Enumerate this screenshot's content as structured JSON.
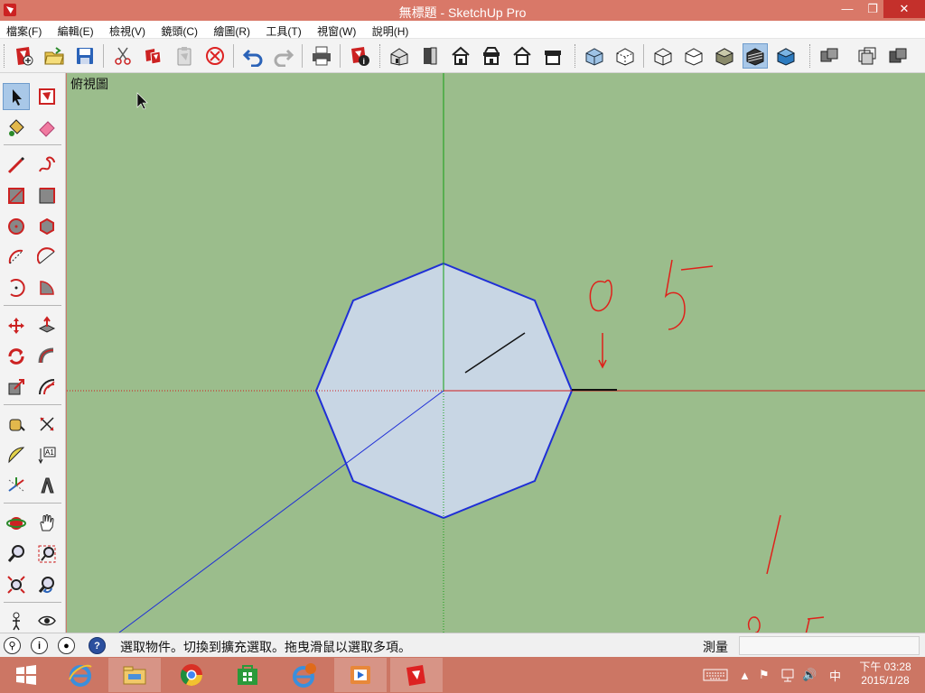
{
  "window": {
    "title": "無標題 - SketchUp Pro",
    "min_label": "—",
    "max_label": "❐",
    "close_label": "✕"
  },
  "menu": [
    {
      "label": "檔案(F)"
    },
    {
      "label": "編輯(E)"
    },
    {
      "label": "檢視(V)"
    },
    {
      "label": "鏡頭(C)"
    },
    {
      "label": "繪圖(R)"
    },
    {
      "label": "工具(T)"
    },
    {
      "label": "視窗(W)"
    },
    {
      "label": "說明(H)"
    }
  ],
  "toolbar_icons": [
    "new-icon",
    "open-icon",
    "save-icon",
    "cut-icon",
    "copy-icon",
    "paste-icon",
    "erase-icon",
    "undo-icon",
    "redo-icon",
    "print-icon",
    "model-info-icon",
    "iso-view-icon",
    "top-view-icon",
    "front-view-icon",
    "right-view-icon",
    "back-view-icon",
    "left-view-icon",
    "xray-icon",
    "back-edges-icon",
    "wireframe-icon",
    "hidden-line-icon",
    "shaded-icon",
    "shaded-textures-icon",
    "monochrome-icon",
    "component-icon",
    "group-icon",
    "outer-shell-icon"
  ],
  "left_tools": [
    "select-icon",
    "make-component-icon",
    "paint-bucket-icon",
    "eraser-icon",
    "line-icon",
    "freehand-icon",
    "rectangle-icon",
    "rotated-rectangle-icon",
    "circle-icon",
    "polygon-icon",
    "arc-icon",
    "two-point-arc-icon",
    "three-point-arc-icon",
    "pie-icon",
    "move-icon",
    "push-pull-icon",
    "rotate-icon",
    "follow-me-icon",
    "scale-icon",
    "offset-icon",
    "tape-measure-icon",
    "dimension-icon",
    "protractor-icon",
    "text-icon",
    "axes-icon",
    "3d-text-icon",
    "orbit-icon",
    "pan-icon",
    "zoom-icon",
    "zoom-window-icon",
    "zoom-extents-icon",
    "previous-view-icon",
    "position-camera-icon",
    "look-around-icon"
  ],
  "viewport": {
    "view_name": "俯視圖",
    "background": "#9bbd8c",
    "polygon_fill": "#c8d6e4",
    "polygon_edge": "#1f2fd6",
    "red_axis": "#d01c1c",
    "green_axis": "#15a015",
    "blue_axis": "#1f2fd6",
    "annotation_color": "#e0201a"
  },
  "status": {
    "message": "選取物件。切換到擴充選取。拖曳滑鼠以選取多項。",
    "measurement_label": "測量",
    "measurement_value": ""
  },
  "taskbar": {
    "apps": [
      "start-icon",
      "internet-explorer-icon",
      "file-explorer-icon",
      "chrome-icon",
      "store-icon",
      "ie-update-icon",
      "media-player-icon",
      "sketchup-icon"
    ],
    "tray_ime": "中",
    "clock_time": "下午 03:28",
    "clock_date": "2015/1/28"
  }
}
